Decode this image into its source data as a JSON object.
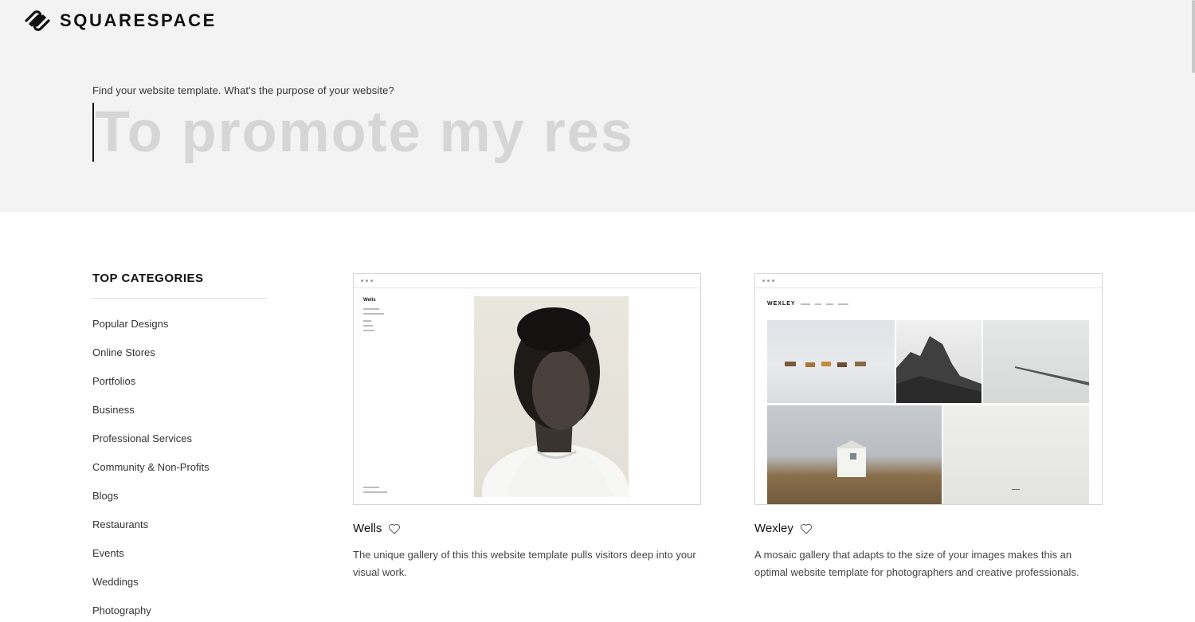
{
  "brand": {
    "name": "SQUARESPACE"
  },
  "hero": {
    "prompt": "Find your website template. What's the purpose of your website?",
    "search_value": "To promote my res"
  },
  "sidebar": {
    "heading": "TOP CATEGORIES",
    "items": [
      {
        "label": "Popular Designs"
      },
      {
        "label": "Online Stores"
      },
      {
        "label": "Portfolios"
      },
      {
        "label": "Business"
      },
      {
        "label": "Professional Services"
      },
      {
        "label": "Community & Non-Profits"
      },
      {
        "label": "Blogs"
      },
      {
        "label": "Restaurants"
      },
      {
        "label": "Events"
      },
      {
        "label": "Weddings"
      },
      {
        "label": "Photography"
      }
    ]
  },
  "templates": [
    {
      "name": "Wells",
      "description": "The unique gallery of this this website template pulls visitors deep into your visual work.",
      "preview_brand": "Wells"
    },
    {
      "name": "Wexley",
      "description": "A mosaic gallery that adapts to the size of your images makes this an optimal website template for photographers and creative professionals.",
      "preview_brand": "WEXLEY"
    }
  ],
  "icons": {
    "logo": "squarespace-logo-icon",
    "favorite": "heart-outline-icon"
  },
  "colors": {
    "hero_bg": "#f3f3f3",
    "text": "#1a1a1a",
    "placeholder_text": "#d6d6d6"
  }
}
